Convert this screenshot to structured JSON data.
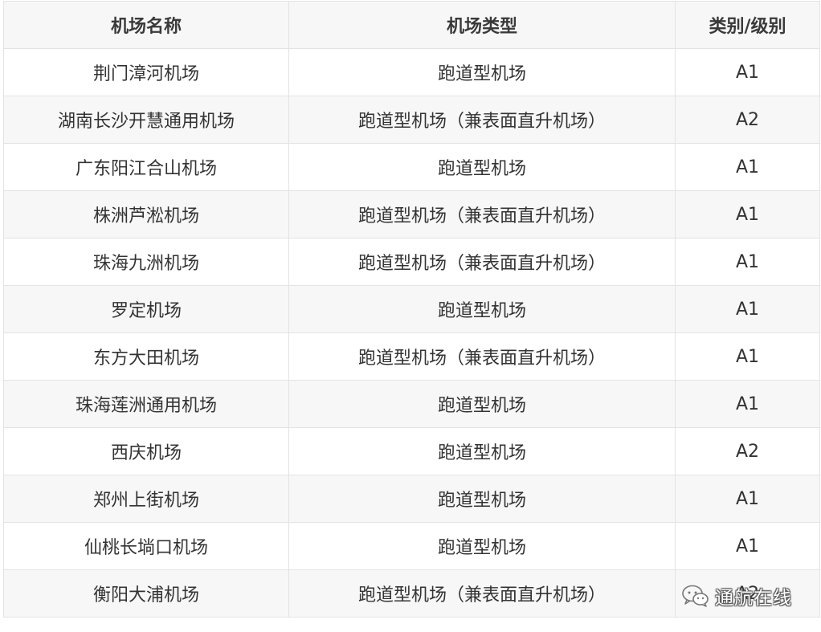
{
  "table": {
    "headers": [
      "机场名称",
      "机场类型",
      "类别/级别"
    ],
    "rows": [
      [
        "荆门漳河机场",
        "跑道型机场",
        "A1"
      ],
      [
        "湖南长沙开慧通用机场",
        "跑道型机场（兼表面直升机场）",
        "A2"
      ],
      [
        "广东阳江合山机场",
        "跑道型机场",
        "A1"
      ],
      [
        "株洲芦淞机场",
        "跑道型机场（兼表面直升机场）",
        "A1"
      ],
      [
        "珠海九洲机场",
        "跑道型机场（兼表面直升机场）",
        "A1"
      ],
      [
        "罗定机场",
        "跑道型机场",
        "A1"
      ],
      [
        "东方大田机场",
        "跑道型机场（兼表面直升机场）",
        "A1"
      ],
      [
        "珠海莲洲通用机场",
        "跑道型机场",
        "A1"
      ],
      [
        "西庆机场",
        "跑道型机场",
        "A2"
      ],
      [
        "郑州上街机场",
        "跑道型机场",
        "A1"
      ],
      [
        "仙桃长埫口机场",
        "跑道型机场",
        "A1"
      ],
      [
        "衡阳大浦机场",
        "跑道型机场（兼表面直升机场）",
        "A2"
      ]
    ]
  },
  "watermark": {
    "icon": "wechat-icon",
    "text": "通航在线"
  }
}
